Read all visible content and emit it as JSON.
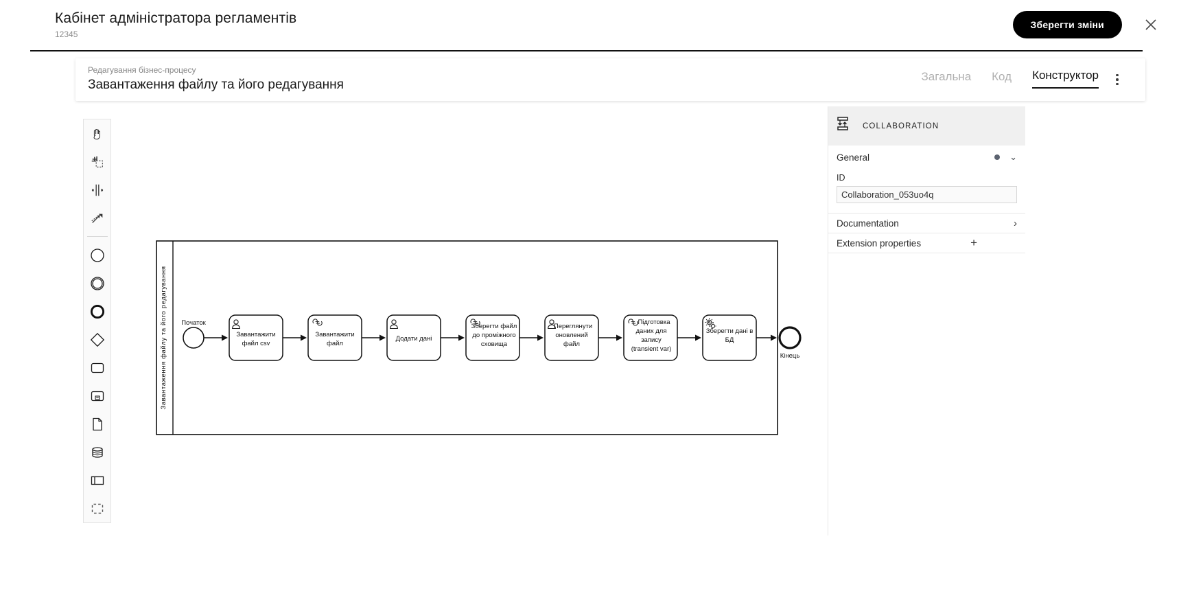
{
  "topbar": {
    "app_title": "Кабінет адміністратора регламентів",
    "app_subtitle": "12345",
    "save_label": "Зберегти зміни",
    "close_icon": "close-icon"
  },
  "card": {
    "eyebrow": "Редагування бізнес-процесу",
    "title": "Завантаження файлу та його редагування",
    "tabs": [
      {
        "label": "Загальна",
        "active": false
      },
      {
        "label": "Код",
        "active": false
      },
      {
        "label": "Конструктор",
        "active": true
      }
    ],
    "menu_icon": "kebab-menu-icon"
  },
  "palette": {
    "items": [
      {
        "name": "hand-tool-icon",
        "title": "Activate the hand tool"
      },
      {
        "name": "lasso-tool-icon",
        "title": "Activate the lasso tool"
      },
      {
        "name": "space-tool-icon",
        "title": "Activate the create/remove space tool"
      },
      {
        "name": "global-connect-tool-icon",
        "title": "Activate the global connect tool"
      },
      {
        "name": "start-event-icon",
        "title": "Create StartEvent"
      },
      {
        "name": "intermediate-event-icon",
        "title": "Create Intermediate/Boundary Event"
      },
      {
        "name": "end-event-icon",
        "title": "Create EndEvent"
      },
      {
        "name": "gateway-icon",
        "title": "Create Gateway"
      },
      {
        "name": "task-icon",
        "title": "Create Task"
      },
      {
        "name": "subprocess-icon",
        "title": "Create expanded SubProcess"
      },
      {
        "name": "data-object-icon",
        "title": "Create DataObjectReference"
      },
      {
        "name": "data-store-icon",
        "title": "Create DataStoreReference"
      },
      {
        "name": "participant-icon",
        "title": "Create Pool/Participant"
      },
      {
        "name": "group-icon",
        "title": "Create Group"
      }
    ]
  },
  "properties": {
    "header_label": "COLLABORATION",
    "header_icon": "collaboration-icon",
    "general": {
      "title": "General",
      "id_label": "ID",
      "id_value": "Collaboration_053uo4q",
      "id_placeholder": "Collaboration_053uo4q"
    },
    "documentation": {
      "label": "Documentation",
      "action": "›"
    },
    "extension_properties": {
      "label": "Extension properties",
      "action": "+"
    }
  },
  "diagram": {
    "pool_label": "Завантаження файлу та його редагування",
    "start_event": {
      "label": "Початок",
      "type": "start-event"
    },
    "end_event": {
      "label": "Кінець",
      "type": "end-event"
    },
    "tasks": [
      {
        "label": [
          "Завантажити",
          "файл csv"
        ],
        "icon": "user-task-icon"
      },
      {
        "label": [
          "Завантажити",
          "файл"
        ],
        "icon": "script-task-icon"
      },
      {
        "label": [
          "Додати дані"
        ],
        "icon": "user-task-icon"
      },
      {
        "label": [
          "Зберегти файл",
          "до проміжного",
          "сховища"
        ],
        "icon": "script-task-icon"
      },
      {
        "label": [
          "Переглянути",
          "оновлений",
          "файл"
        ],
        "icon": "user-task-icon"
      },
      {
        "label": [
          "Підготовка",
          "даних для",
          "запису",
          "(transient var)"
        ],
        "icon": "script-task-icon"
      },
      {
        "label": [
          "Зберегти дані в",
          "БД"
        ],
        "icon": "service-task-icon"
      }
    ]
  },
  "colors": {
    "accent": "#000000",
    "text_primary": "#1a1a1a",
    "text_muted": "#8c8c8c",
    "tab_inactive": "#b0b0b0",
    "panel_header_bg": "#f0f0f0"
  }
}
